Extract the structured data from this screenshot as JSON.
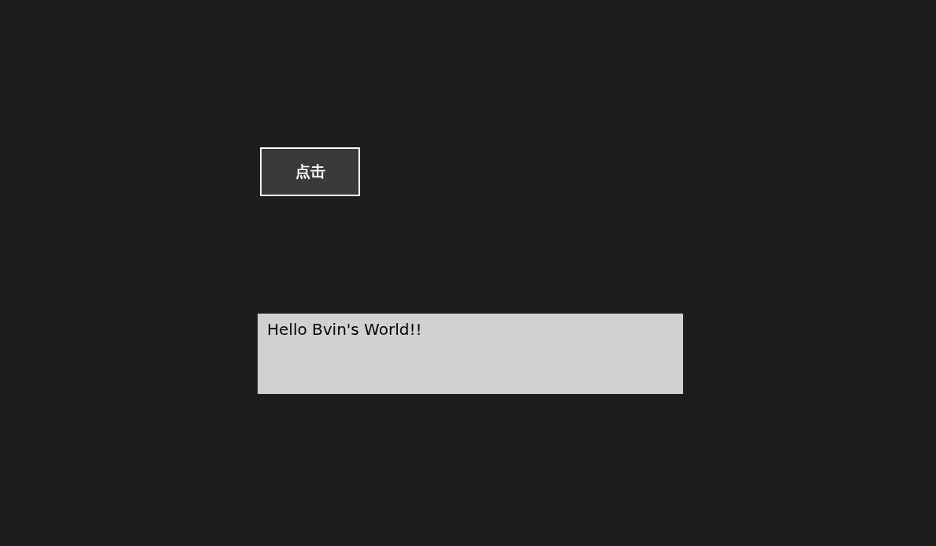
{
  "button": {
    "label": "点击"
  },
  "text_box": {
    "value": "Hello Bvin's World!!"
  }
}
